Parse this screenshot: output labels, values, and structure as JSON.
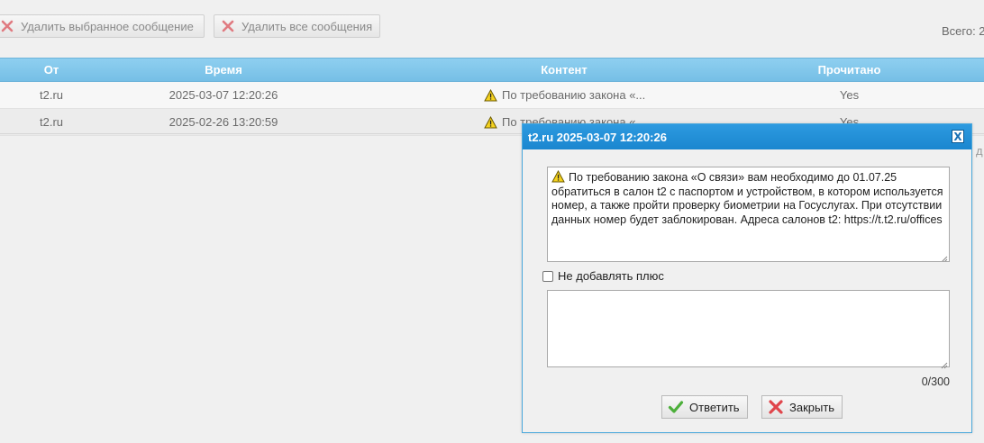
{
  "toolbar": {
    "delete_selected_label": "Удалить выбранное сообщение",
    "delete_all_label": "Удалить все сообщения",
    "total_label": "Всего: 2"
  },
  "table": {
    "headers": {
      "from": "От",
      "time": "Время",
      "content": "Контент",
      "read": "Прочитано"
    },
    "rows": [
      {
        "from": "t2.ru",
        "time": "2025-03-07 12:20:26",
        "content": "По требованию закона «...",
        "read": "Yes"
      },
      {
        "from": "t2.ru",
        "time": "2025-02-26 13:20:59",
        "content": "По требованию закона «...",
        "read": "Yes"
      }
    ]
  },
  "dialog": {
    "title": "t2.ru 2025-03-07 12:20:26",
    "close_x": "X",
    "message": "По требованию закона «О связи» вам необходимо до 01.07.25 обратиться в салон t2 с паспортом и устройством, в котором используется номер, а также пройти проверку биометрии на Госуслугах. При отсутствии данных номер будет заблокирован. Адреса салонов t2: https://t.t2.ru/offices",
    "no_plus_label": "Не добавлять плюс",
    "no_plus_checked": false,
    "reply_text": "",
    "counter": "0/300",
    "reply_button": "Ответить",
    "close_button": "Закрыть"
  },
  "edge_glyph": "д",
  "colors": {
    "header_blue": "#80c6ec",
    "dialog_title_blue": "#2290d8",
    "warn_yellow": "#f5d21e",
    "delete_red": "#e0454b",
    "ok_green": "#4caf3a"
  },
  "icons": {
    "warning": "warning-icon",
    "delete": "x-icon",
    "ok": "check-icon"
  }
}
